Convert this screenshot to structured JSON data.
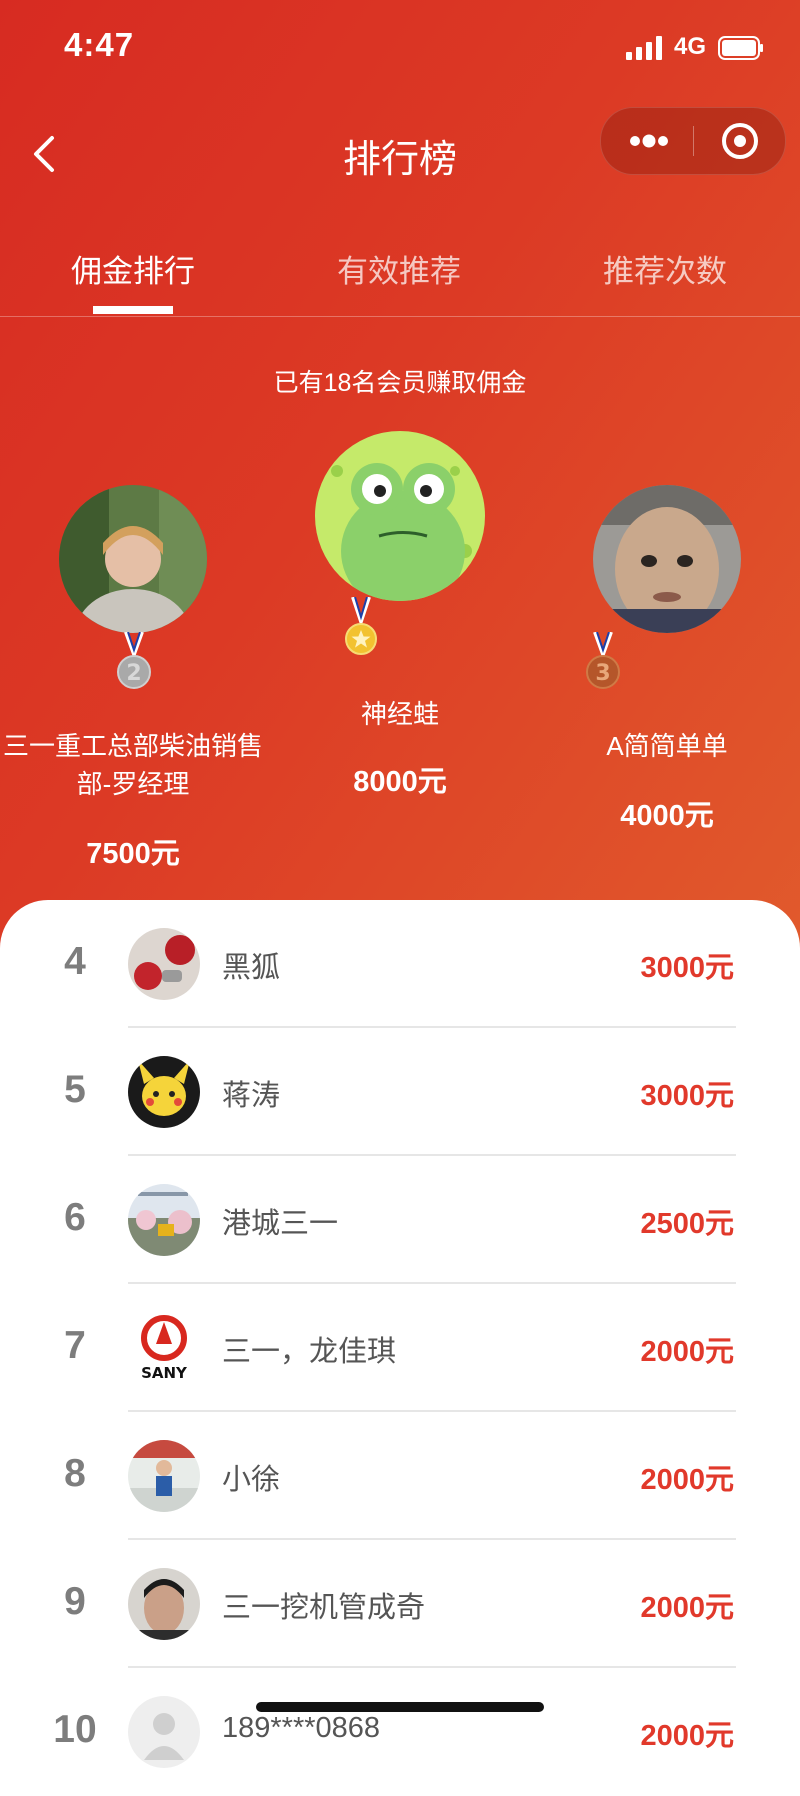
{
  "status_bar": {
    "time": "4:47",
    "network": "4G"
  },
  "nav": {
    "title": "排行榜",
    "back_icon": "chevron-left-icon",
    "more_icon": "more-dots-icon",
    "close_icon": "target-close-icon"
  },
  "tabs": [
    {
      "label": "佣金排行",
      "active": true
    },
    {
      "label": "有效推荐",
      "active": false
    },
    {
      "label": "推荐次数",
      "active": false
    }
  ],
  "summary": "已有18名会员赚取佣金",
  "podium": {
    "first": {
      "rank": "1",
      "name": "神经蛙",
      "amount": "8000元"
    },
    "second": {
      "rank": "2",
      "name_line1": "三一重工总部柴油销售",
      "name_line2": "部-罗经理",
      "amount": "7500元"
    },
    "third": {
      "rank": "3",
      "name": "A简简单单",
      "amount": "4000元"
    }
  },
  "list": [
    {
      "rank": "4",
      "name": "黑狐",
      "amount": "3000元"
    },
    {
      "rank": "5",
      "name": "蒋涛",
      "amount": "3000元"
    },
    {
      "rank": "6",
      "name": "港城三一",
      "amount": "2500元"
    },
    {
      "rank": "7",
      "name": "三一，龙佳琪",
      "amount": "2000元"
    },
    {
      "rank": "8",
      "name": "小徐",
      "amount": "2000元"
    },
    {
      "rank": "9",
      "name": "三一挖机管成奇",
      "amount": "2000元"
    },
    {
      "rank": "10",
      "name": "189****0868",
      "amount": "2000元"
    }
  ],
  "logo_text": "SANY",
  "colors": {
    "hero_start": "#d72b22",
    "hero_end": "#e15a2c",
    "amount": "#e1392b",
    "gold": "#f2c230",
    "silver": "#a9a9a9",
    "bronze": "#b5562a"
  }
}
